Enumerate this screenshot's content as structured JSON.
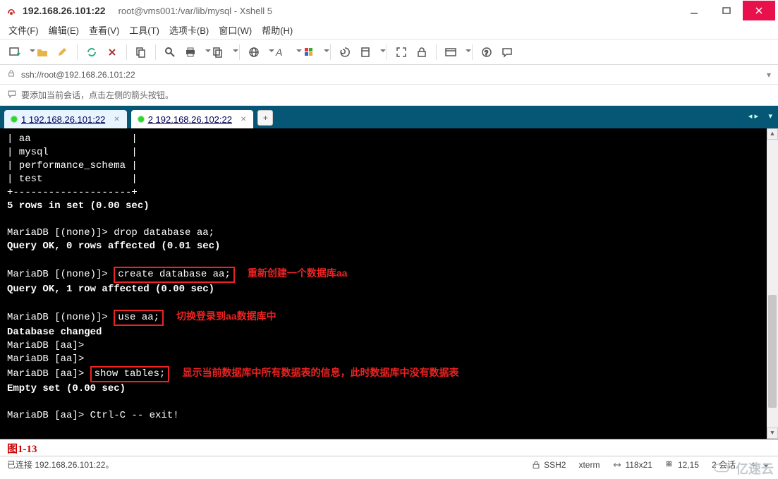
{
  "title": {
    "host": "192.168.26.101:22",
    "path": "root@vms001:/var/lib/mysql - Xshell 5"
  },
  "menu": [
    "文件(F)",
    "编辑(E)",
    "查看(V)",
    "工具(T)",
    "选项卡(B)",
    "窗口(W)",
    "帮助(H)"
  ],
  "address": {
    "scheme_icon": "lock-icon",
    "url": "ssh://root@192.168.26.101:22"
  },
  "hint": "要添加当前会话，点击左侧的箭头按钮。",
  "tabs": [
    {
      "index": "1",
      "label": "192.168.26.101:22",
      "active": true
    },
    {
      "index": "2",
      "label": "192.168.26.102:22",
      "active": false
    }
  ],
  "terminal": {
    "dbrow1": "| aa                 |",
    "dbrow2": "| mysql              |",
    "dbrow3": "| performance_schema |",
    "dbrow4": "| test               |",
    "sep": "+--------------------+",
    "rowsinset": "5 rows in set (0.00 sec)",
    "prompt_none": "MariaDB [(none)]>",
    "prompt_aa": "MariaDB [aa]>",
    "drop_cmd": " drop database aa;",
    "drop_res": "Query OK, 0 rows affected (0.01 sec)",
    "create_cmd": "create database aa;",
    "create_anno": "重新创建一个数据库aa",
    "create_res": "Query OK, 1 row affected (0.00 sec)",
    "use_cmd": "use aa;",
    "use_anno": "切换登录到aa数据库中",
    "use_res": "Database changed",
    "show_cmd": "show tables;",
    "show_anno": "显示当前数据库中所有数据表的信息，此时数据库中没有数据表",
    "show_res": "Empty set (0.00 sec)",
    "exit_cmd": " Ctrl-C -- exit!"
  },
  "figure_label": "图1-13",
  "status": {
    "left": "已连接 192.168.26.101:22。",
    "proto": "SSH2",
    "term": "xterm",
    "size": "118x21",
    "pos": "12,15",
    "sessions": "2 会话"
  },
  "watermark": "亿速云"
}
